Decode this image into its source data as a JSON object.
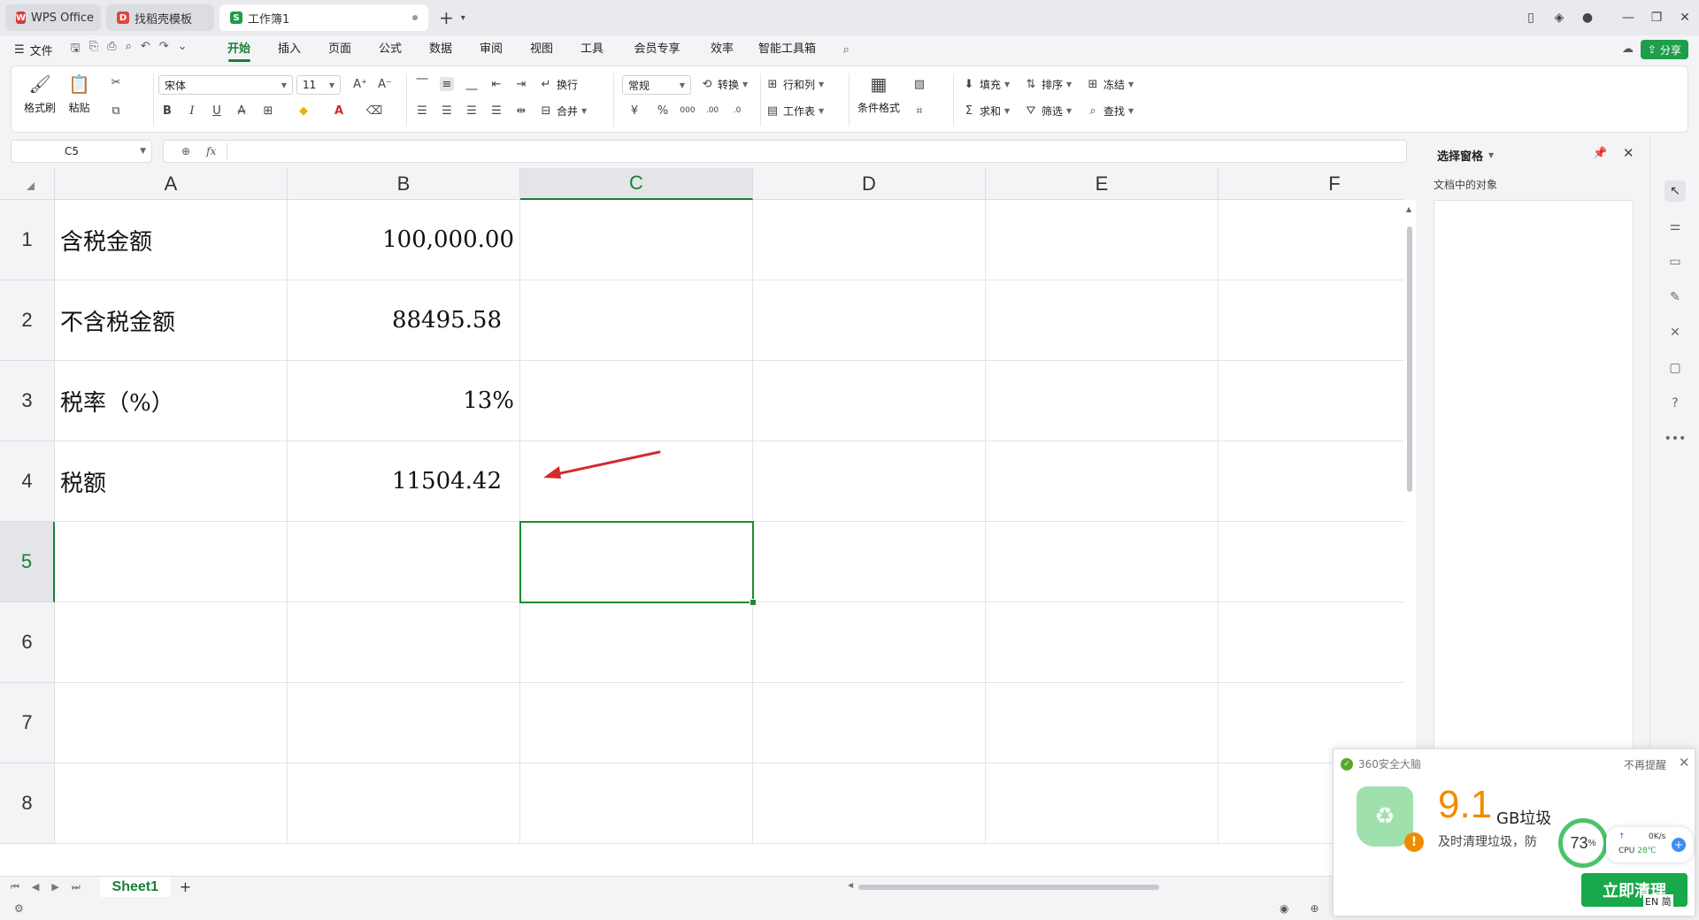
{
  "titlebar": {
    "tabs": [
      {
        "label": "WPS Office",
        "logo": "W",
        "color": "#d83b3b"
      },
      {
        "label": "找稻壳模板",
        "logo": "D",
        "color": "#e0463c"
      },
      {
        "label": "工作簿1",
        "logo": "S",
        "color": "#1e9e4a"
      }
    ],
    "new_tab": "+"
  },
  "menubar": {
    "file_label": "文件",
    "menus": [
      "开始",
      "插入",
      "页面",
      "公式",
      "数据",
      "审阅",
      "视图",
      "工具",
      "会员专享",
      "效率",
      "智能工具箱"
    ],
    "active_menu": "开始",
    "share_label": "分享"
  },
  "ribbon": {
    "format_painter": "格式刷",
    "paste": "粘贴",
    "font_name": "宋体",
    "font_size": "11",
    "wrap": "换行",
    "merge": "合并",
    "number_format": "常规",
    "convert": "转换",
    "rows_cols": "行和列",
    "worksheet": "工作表",
    "cond_format": "条件格式",
    "fill": "填充",
    "sort": "排序",
    "freeze": "冻结",
    "sum": "求和",
    "filter": "筛选",
    "find": "查找",
    "bold": "B",
    "italic": "I",
    "underline": "U",
    "percent": "%",
    "yen": "¥"
  },
  "formula_bar": {
    "name_box": "C5",
    "fx": "fx",
    "content": ""
  },
  "grid": {
    "columns": [
      "A",
      "B",
      "C",
      "D",
      "E",
      "F"
    ],
    "rows": [
      "1",
      "2",
      "3",
      "4",
      "5",
      "6",
      "7",
      "8"
    ],
    "active_cell": "C5",
    "cells": {
      "A1": "含税金额",
      "B1": "100,000.00",
      "A2": "不含税金额",
      "B2": "88495.58",
      "A3": "税率（%）",
      "B3": "13%",
      "A4": "税额",
      "B4": "11504.42"
    }
  },
  "sheets": {
    "tabs": [
      "Sheet1"
    ],
    "add": "+"
  },
  "selection_pane": {
    "title": "选择窗格",
    "subtitle": "文档中的对象"
  },
  "popup_360": {
    "app_name": "360安全大脑",
    "dismiss": "不再提醒",
    "amount": "9.1",
    "unit": "GB垃圾",
    "description": "及时清理垃圾，防",
    "cpu_percent": "73",
    "percent_sign": "%",
    "net_speed": "0K/s",
    "cpu_label": "CPU",
    "cpu_temp": "28℃",
    "button": "立即清理",
    "ime": "EN 简"
  },
  "colors": {
    "accent": "#1a7f37",
    "selection_border": "#1e8a2e",
    "arrow": "#d42a2a",
    "popup_orange": "#f28b00",
    "popup_green": "#19a84a"
  }
}
